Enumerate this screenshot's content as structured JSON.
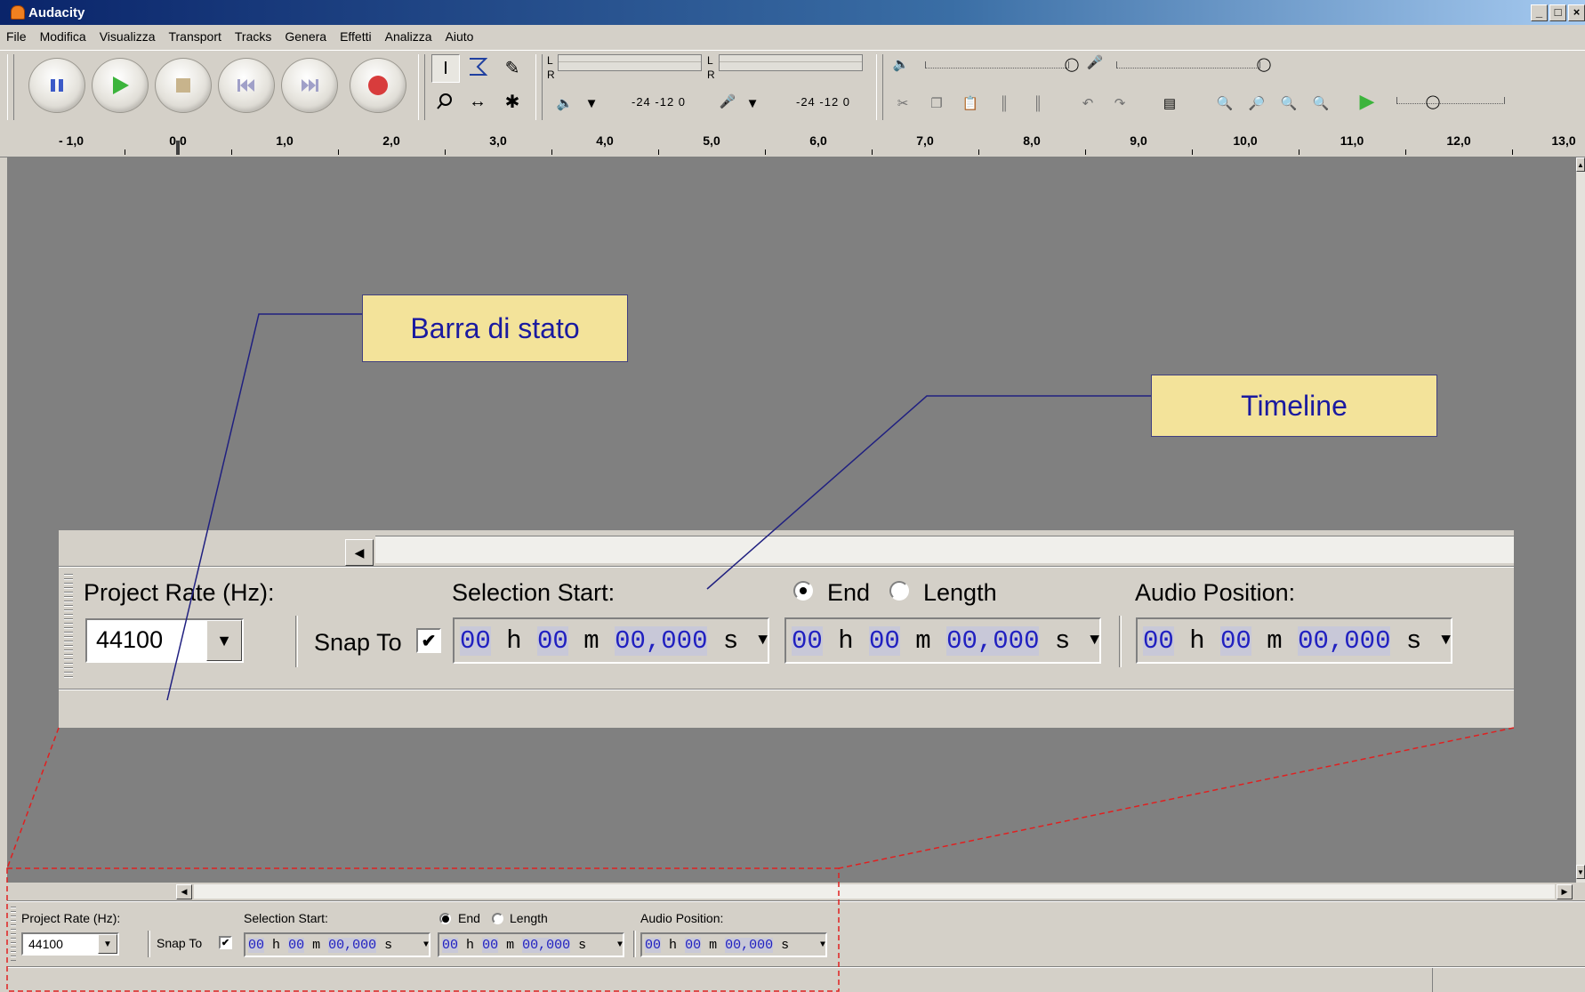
{
  "window": {
    "title": "Audacity"
  },
  "menu": [
    "File",
    "Modifica",
    "Visualizza",
    "Transport",
    "Tracks",
    "Genera",
    "Effetti",
    "Analizza",
    "Aiuto"
  ],
  "meters": {
    "playback_ticks": "-24 -12 0",
    "record_ticks": "-24 -12 0",
    "left": "L",
    "right": "R"
  },
  "ruler": {
    "labels": [
      "- 1,0",
      "0,0",
      "1,0",
      "2,0",
      "3,0",
      "4,0",
      "5,0",
      "6,0",
      "7,0",
      "8,0",
      "9,0",
      "10,0",
      "11,0",
      "12,0",
      "13,0"
    ]
  },
  "callouts": {
    "status_bar": "Barra di stato",
    "timeline": "Timeline"
  },
  "selection_bar": {
    "project_rate_label": "Project Rate (Hz):",
    "project_rate_value": "44100",
    "snap_to_label": "Snap To",
    "snap_to_checked": true,
    "selection_start_label": "Selection Start:",
    "end_label": "End",
    "length_label": "Length",
    "end_selected": true,
    "audio_position_label": "Audio Position:",
    "time": {
      "h": "00",
      "h_unit": "h",
      "m": "00",
      "m_unit": "m",
      "s": "00,000",
      "s_unit": "s"
    }
  },
  "colors": {
    "callout_fill": "#f3e39a",
    "callout_text": "#1a1aa0",
    "track_area": "#808080",
    "dashed_outline": "#e02020",
    "leader_line": "#202080"
  }
}
